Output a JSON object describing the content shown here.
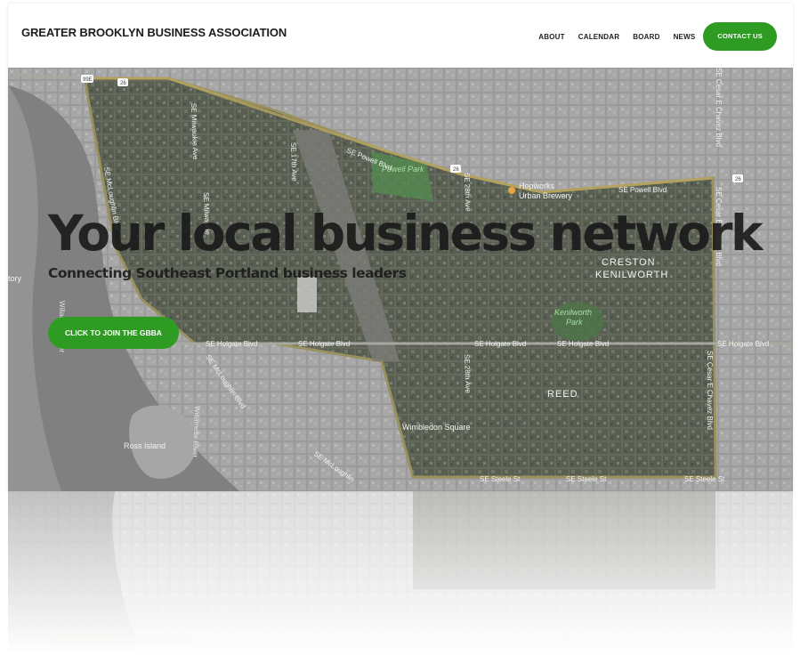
{
  "site": {
    "brand": "GREATER BROOKLYN BUSINESS ASSOCIATION"
  },
  "nav": {
    "items": [
      "ABOUT",
      "CALENDAR",
      "BOARD",
      "NEWS"
    ],
    "contact": "CONTACT US"
  },
  "hero": {
    "title": "Your local business network",
    "subtitle": "Connecting Southeast Portland business leaders",
    "cta": "CLICK TO JOIN THE GBBA"
  },
  "map": {
    "labels": {
      "powell_park": "Powell Park",
      "hopworks": "Hopworks",
      "urban_brewery": "Urban Brewery",
      "creston": "CRESTON",
      "kenilworth": "KENILWORTH",
      "kenilworth_park": "Kenilworth",
      "kenilworth_park2": "Park",
      "reed": "REED",
      "wimbledon": "Wimbledon Square",
      "ross_island": "Ross Island",
      "willamette1": "Willamette River",
      "willamette2": "Willamette River",
      "story": "tory",
      "se_powell1": "SE Powell Blvd",
      "se_powell2": "SE Powell Blvd",
      "se_holgate1": "SE Holgate Blvd",
      "se_holgate2": "SE Holgate Blvd",
      "se_holgate3": "SE Holgate Blvd",
      "se_holgate4": "SE Holgate Blvd",
      "se_holgate5": "SE Holgate Blvd",
      "se_steele1": "SE Steele St",
      "se_steele2": "SE Steele St",
      "se_steele3": "SE Steele St",
      "se_mcloughlin1": "SE McLoughlin Blvd",
      "se_mcloughlin2": "SE McLoughlin Blvd",
      "se_mcloughlin3": "SE McLoughlin",
      "se_milwaukie1": "SE Milwaukie Ave",
      "se_milwaukie2": "SE Milwaukie",
      "se_17th": "SE 17th Ave",
      "se_28th1": "SE 28th Ave",
      "se_28th2": "SE 28th Ave",
      "se_cesar1": "SE Cesar E Chavez Blvd",
      "se_cesar2": "SE Cesar E Chavez Blvd",
      "se_cesar3": "SE Cesar E Chavez Blvd",
      "shield_99e": "99E",
      "shield_26a": "26",
      "shield_26b": "26",
      "shield_26c": "26"
    }
  },
  "colors": {
    "accent": "#2e9b22",
    "text": "#1d1d1d"
  }
}
